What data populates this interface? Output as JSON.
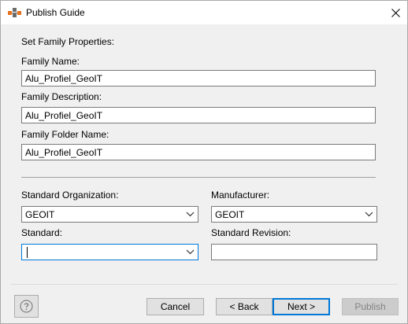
{
  "window": {
    "title": "Publish Guide",
    "app_icon": "app-icon",
    "close_icon": "close-icon"
  },
  "section_heading": "Set Family Properties:",
  "family_name": {
    "label": "Family Name:",
    "value": "Alu_Profiel_GeoIT"
  },
  "family_description": {
    "label": "Family Description:",
    "value": "Alu_Profiel_GeoIT"
  },
  "family_folder_name": {
    "label": "Family Folder Name:",
    "value": "Alu_Profiel_GeoIT"
  },
  "standard_organization": {
    "label": "Standard Organization:",
    "value": "GEOIT"
  },
  "manufacturer": {
    "label": "Manufacturer:",
    "value": "GEOIT"
  },
  "standard": {
    "label": "Standard:",
    "value": ""
  },
  "standard_revision": {
    "label": "Standard Revision:",
    "value": ""
  },
  "footer": {
    "help_icon": "help-icon",
    "cancel_label": "Cancel",
    "back_label": "< Back",
    "next_label": "Next >",
    "publish_label": "Publish"
  },
  "colors": {
    "accent": "#0078d7",
    "icon_orange": "#e8711f",
    "icon_gray": "#6b6b6b"
  }
}
